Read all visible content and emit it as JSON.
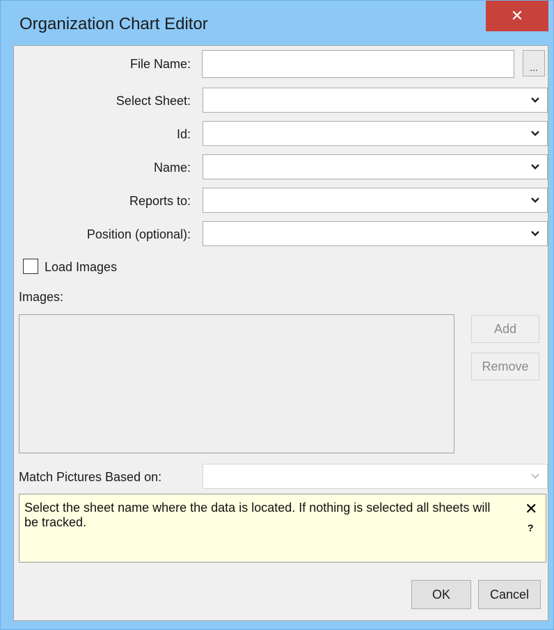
{
  "window": {
    "title": "Organization Chart Editor",
    "close_symbol": "✕"
  },
  "form": {
    "file_name": {
      "label": "File Name:",
      "value": "",
      "browse_label": "..."
    },
    "select_sheet": {
      "label": "Select Sheet:",
      "value": ""
    },
    "id": {
      "label": "Id:",
      "value": ""
    },
    "name": {
      "label": "Name:",
      "value": ""
    },
    "reports_to": {
      "label": "Reports to:",
      "value": ""
    },
    "position": {
      "label": "Position (optional):",
      "value": ""
    },
    "load_images": {
      "label": "Load Images",
      "checked": false
    },
    "images": {
      "label": "Images:",
      "items": []
    },
    "add_label": "Add",
    "remove_label": "Remove",
    "match_pictures": {
      "label": "Match Pictures Based on:",
      "value": ""
    }
  },
  "tip": {
    "text": "Select the sheet name where the data is located. If nothing is selected all sheets will be tracked.",
    "close_symbol": "✕",
    "help_symbol": "?"
  },
  "footer": {
    "ok_label": "OK",
    "cancel_label": "Cancel"
  }
}
